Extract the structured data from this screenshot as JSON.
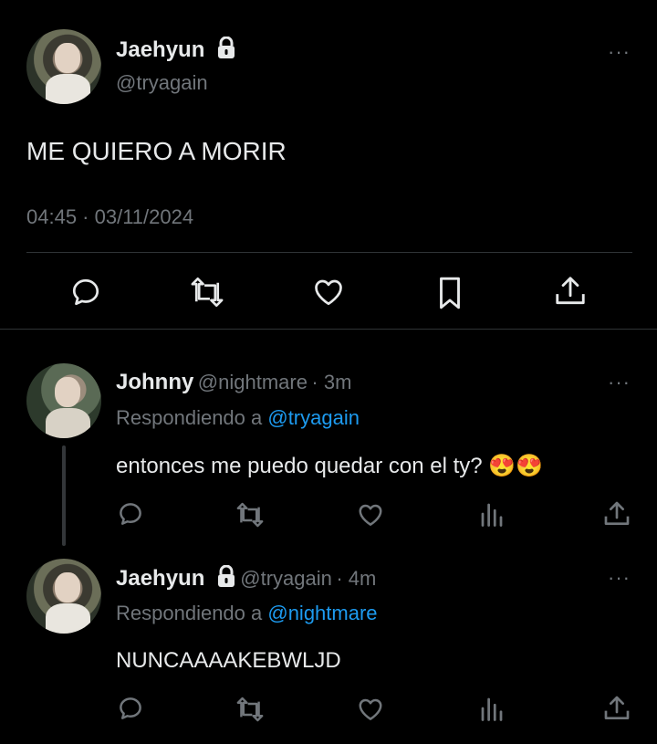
{
  "main_tweet": {
    "author_name": "Jaehyun",
    "handle": "@tryagain",
    "text": "ME QUIERO A MORIR",
    "timestamp": "04:45 · 03/11/2024",
    "more": "···"
  },
  "replies": [
    {
      "author_name": "Johnny",
      "handle": "@nightmare",
      "time": "· 3m",
      "replying_label": "Respondiendo a ",
      "replying_to": "@tryagain",
      "text": "entonces me puedo quedar con el ty? 😍😍",
      "more": "···"
    },
    {
      "author_name": "Jaehyun",
      "handle": "@tryagain",
      "time": "· 4m",
      "replying_label": "Respondiendo a ",
      "replying_to": "@nightmare",
      "text": "NUNCAAAAKEBWLJD",
      "more": "···"
    }
  ],
  "colors": {
    "background": "#000000",
    "text": "#e7e9ea",
    "secondary": "#71767b",
    "accent": "#1d9bf0",
    "divider": "#2f3336"
  },
  "icons": [
    "reply-icon",
    "retweet-icon",
    "like-icon",
    "bookmark-icon",
    "share-icon",
    "views-icon",
    "lock-icon"
  ]
}
